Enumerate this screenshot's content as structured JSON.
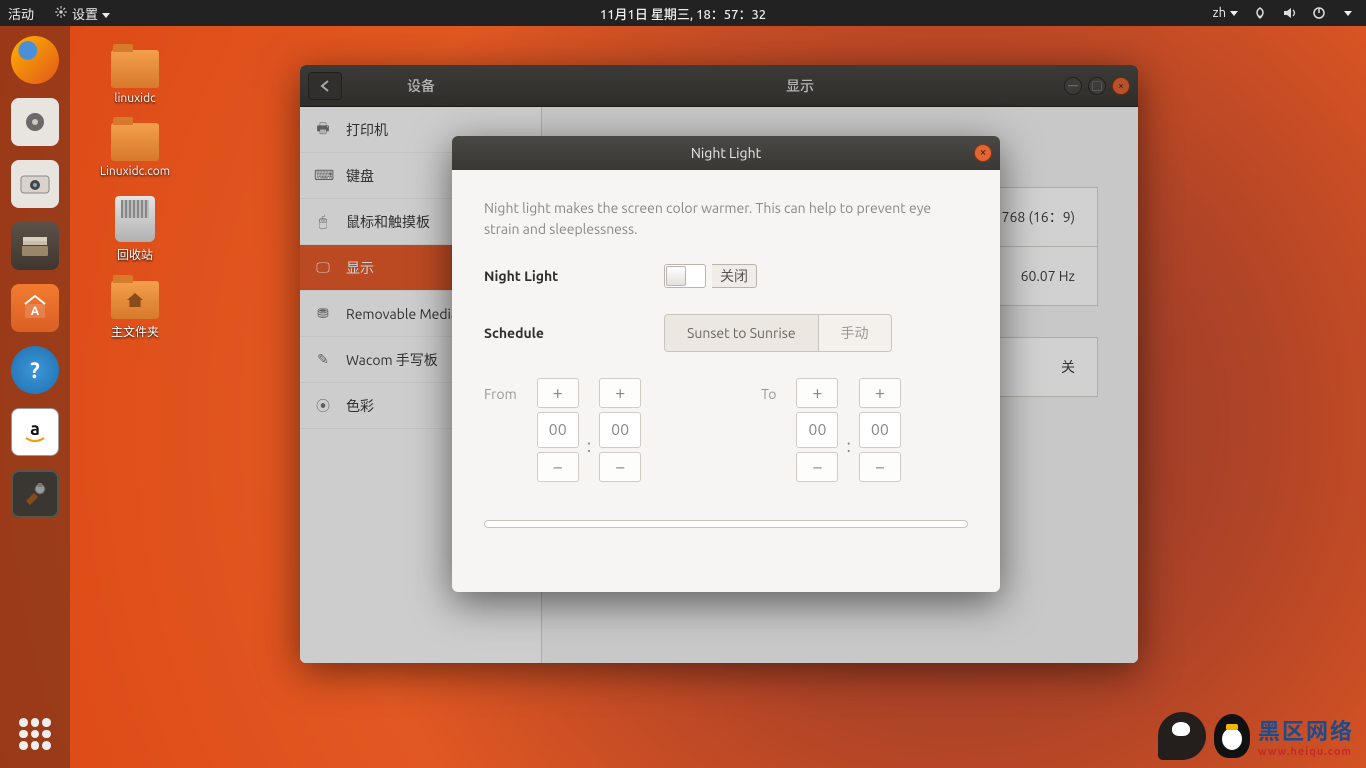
{
  "topbar": {
    "activities": "活动",
    "app_menu": "设置",
    "clock": "11月1日 星期三, 18：57：32",
    "input_method": "zh"
  },
  "desktop_icons": {
    "folder1": "linuxidc",
    "folder2": "Linuxidc.com",
    "trash": "回收站",
    "home": "主文件夹"
  },
  "settings_window": {
    "header_left": "设备",
    "header_right": "显示",
    "sidebar": {
      "items": [
        {
          "icon": "🖶",
          "label": "打印机"
        },
        {
          "icon": "⌨",
          "label": "键盘"
        },
        {
          "icon": "🖱",
          "label": "鼠标和触摸板"
        },
        {
          "icon": "🖵",
          "label": "显示"
        },
        {
          "icon": "⛃",
          "label": "Removable Media"
        },
        {
          "icon": "✎",
          "label": "Wacom 手写板"
        },
        {
          "icon": "⦿",
          "label": "色彩"
        }
      ]
    },
    "content": {
      "resolution": "768 (16：9)",
      "refresh": "60.07 Hz",
      "night_toggle": "关"
    }
  },
  "dialog": {
    "title": "Night Light",
    "description": "Night light makes the screen color warmer. This can help to prevent eye strain and sleeplessness.",
    "label_nightlight": "Night Light",
    "switch_state": "关闭",
    "label_schedule": "Schedule",
    "seg_auto": "Sunset to Sunrise",
    "seg_manual": "手动",
    "from_label": "From",
    "to_label": "To",
    "from_h": "00",
    "from_m": "00",
    "to_h": "00",
    "to_m": "00",
    "plus": "+",
    "minus": "−"
  },
  "watermark": {
    "line1": "黑区网络",
    "line2": "www.heiqu.com"
  }
}
